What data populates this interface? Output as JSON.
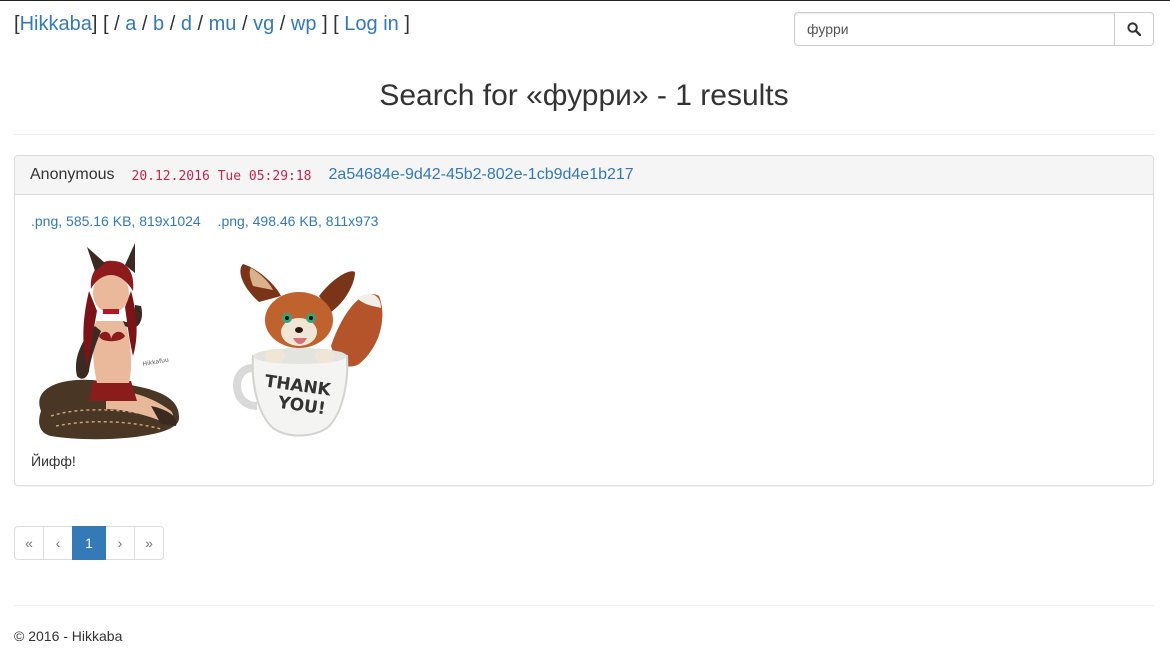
{
  "nav": {
    "home": "Hikkaba",
    "boards": [
      "a",
      "b",
      "d",
      "mu",
      "vg",
      "wp"
    ],
    "login": "Log in"
  },
  "search": {
    "value": "фурри",
    "icon": "search-icon"
  },
  "title": "Search for «фурри» - 1 results",
  "post": {
    "author": "Anonymous",
    "date": "20.12.2016 Tue 05:29:18",
    "id": "2a54684e-9d42-45b2-802e-1cb9d4e1b217",
    "files": [
      {
        "label": ".png, 585.16 KB, 819x1024"
      },
      {
        "label": ".png, 498.46 KB, 811x973"
      }
    ],
    "thumb2_caption": [
      "THANK",
      "YOU!"
    ],
    "message": "Йифф!"
  },
  "pagination": {
    "first": "«",
    "prev": "‹",
    "current": "1",
    "next": "›",
    "last": "»"
  },
  "footer": "© 2016 - Hikkaba",
  "colors": {
    "link": "#337ab7",
    "date": "#c7254e",
    "active_page": "#337ab7"
  }
}
